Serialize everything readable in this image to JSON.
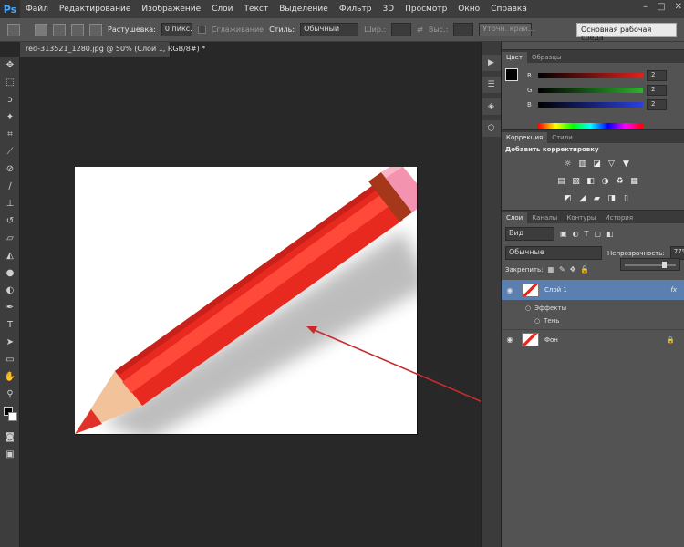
{
  "app": {
    "logo": "Ps"
  },
  "menu": [
    "Файл",
    "Редактирование",
    "Изображение",
    "Слои",
    "Текст",
    "Выделение",
    "Фильтр",
    "3D",
    "Просмотр",
    "Окно",
    "Справка"
  ],
  "window_controls": [
    "–",
    "□",
    "✕"
  ],
  "options_bar": {
    "feather_label": "Растушевка:",
    "feather_value": "0 пикс.",
    "antialias_label": "Сглаживание",
    "style_label": "Стиль:",
    "style_value": "Обычный",
    "width_label": "Шир.:",
    "height_label": "Выс.:",
    "refine_label": "Уточн. край...",
    "workspace_value": "Основная рабочая среда"
  },
  "document_tab": "red-313521_1280.jpg @ 50% (Слой 1, RGB/8#) *",
  "panels": {
    "color": {
      "tabs": [
        "Цвет",
        "Образцы"
      ],
      "channels": [
        {
          "name": "R",
          "value": "2",
          "color": "#e02020"
        },
        {
          "name": "G",
          "value": "2",
          "color": "#2fb02f"
        },
        {
          "name": "B",
          "value": "2",
          "color": "#2a40e0"
        }
      ]
    },
    "adjustments": {
      "tabs": [
        "Коррекция",
        "Стили"
      ],
      "title": "Добавить корректировку",
      "row1": [
        "☼",
        "▥",
        "◪",
        "▽",
        "▼"
      ],
      "row2": [
        "▤",
        "▧",
        "◧",
        "◑",
        "♻",
        "▦"
      ],
      "row3": [
        "◩",
        "◢",
        "▰",
        "◨",
        "▯"
      ]
    },
    "layers": {
      "tabs": [
        "Слои",
        "Каналы",
        "Контуры",
        "История"
      ],
      "kind_value": "Вид",
      "blend_value": "Обычные",
      "opacity_label": "Непрозрачность:",
      "opacity_value": "77%",
      "opacity_fraction": 0.77,
      "lock_label": "Закрепить:",
      "layers": [
        {
          "name": "Слой 1",
          "fx": "fx",
          "effects_label": "Эффекты",
          "effect": "Тень"
        },
        {
          "name": "Фон"
        }
      ]
    }
  },
  "colors": {
    "accent_red": "#c92a2a",
    "selected_layer": "#5b7fae",
    "menubar": "#3d3d3d",
    "panel": "#535353"
  }
}
